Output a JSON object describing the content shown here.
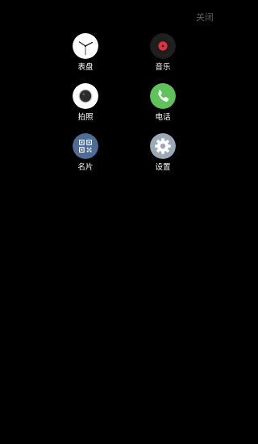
{
  "header": {
    "close_label": "关闭"
  },
  "apps": [
    {
      "label": "表盘",
      "icon": "clock-icon"
    },
    {
      "label": "音乐",
      "icon": "music-disc-icon"
    },
    {
      "label": "拍照",
      "icon": "camera-icon"
    },
    {
      "label": "电话",
      "icon": "phone-icon"
    },
    {
      "label": "名片",
      "icon": "qr-code-icon"
    },
    {
      "label": "设置",
      "icon": "gear-icon"
    }
  ],
  "colors": {
    "background": "#000000",
    "close_text": "#5f5f5f",
    "label_text": "#ffffff",
    "music_disc": "#1e1e1e",
    "music_center": "#e0323c",
    "phone_green": "#5ec45a",
    "qr_blue": "#4d6d96",
    "settings_gray": "#9aa9b6"
  }
}
